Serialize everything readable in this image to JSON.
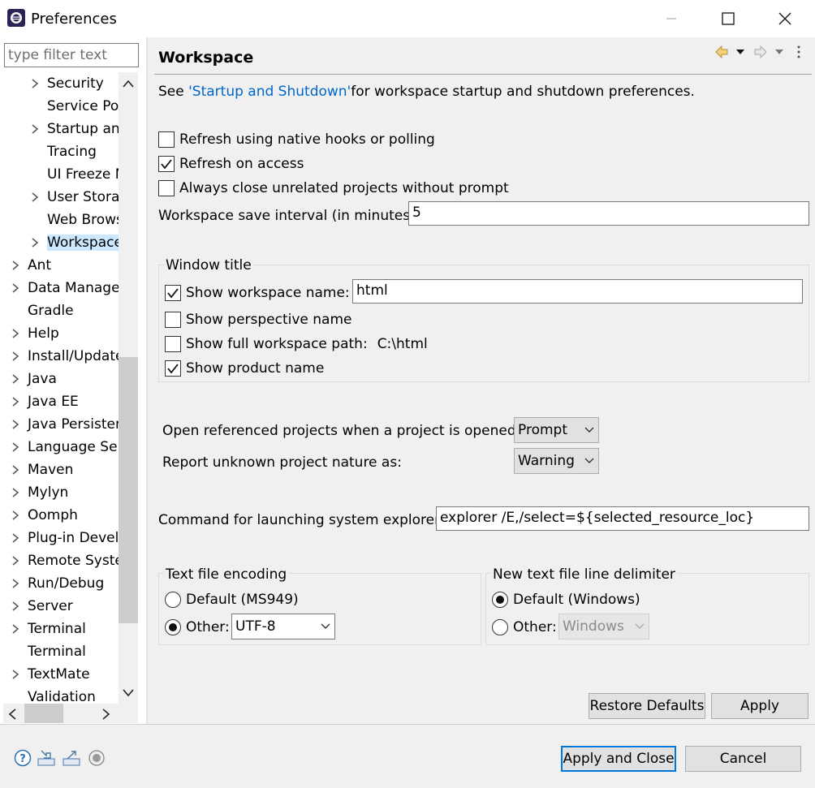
{
  "window": {
    "title": "Preferences"
  },
  "filter": {
    "placeholder": "type filter text"
  },
  "tree": {
    "items": [
      {
        "label": "Security",
        "expandable": true,
        "indent": 1
      },
      {
        "label": "Service Pol",
        "expandable": false,
        "indent": 1
      },
      {
        "label": "Startup and",
        "expandable": true,
        "indent": 1
      },
      {
        "label": "Tracing",
        "expandable": false,
        "indent": 1
      },
      {
        "label": "UI Freeze M",
        "expandable": false,
        "indent": 1
      },
      {
        "label": "User Storag",
        "expandable": true,
        "indent": 1
      },
      {
        "label": "Web Brows",
        "expandable": false,
        "indent": 1
      },
      {
        "label": "Workspace",
        "expandable": true,
        "indent": 1,
        "selected": true
      },
      {
        "label": "Ant",
        "expandable": true,
        "indent": 0
      },
      {
        "label": "Data Manager",
        "expandable": true,
        "indent": 0
      },
      {
        "label": "Gradle",
        "expandable": false,
        "indent": 0
      },
      {
        "label": "Help",
        "expandable": true,
        "indent": 0
      },
      {
        "label": "Install/Update",
        "expandable": true,
        "indent": 0
      },
      {
        "label": "Java",
        "expandable": true,
        "indent": 0
      },
      {
        "label": "Java EE",
        "expandable": true,
        "indent": 0
      },
      {
        "label": "Java Persisten",
        "expandable": true,
        "indent": 0
      },
      {
        "label": "Language Ser",
        "expandable": true,
        "indent": 0
      },
      {
        "label": "Maven",
        "expandable": true,
        "indent": 0
      },
      {
        "label": "Mylyn",
        "expandable": true,
        "indent": 0
      },
      {
        "label": "Oomph",
        "expandable": true,
        "indent": 0
      },
      {
        "label": "Plug-in Devel",
        "expandable": true,
        "indent": 0
      },
      {
        "label": "Remote Syste",
        "expandable": true,
        "indent": 0
      },
      {
        "label": "Run/Debug",
        "expandable": true,
        "indent": 0
      },
      {
        "label": "Server",
        "expandable": true,
        "indent": 0
      },
      {
        "label": "Terminal",
        "expandable": true,
        "indent": 0
      },
      {
        "label": "Terminal",
        "expandable": false,
        "indent": 0
      },
      {
        "label": "TextMate",
        "expandable": true,
        "indent": 0
      },
      {
        "label": "Validation",
        "expandable": false,
        "indent": 0
      }
    ]
  },
  "page": {
    "title": "Workspace",
    "intro_before": "See ",
    "intro_link": "'Startup and Shutdown'",
    "intro_after": " for workspace startup and shutdown preferences.",
    "refresh_native": {
      "label": "Refresh using native hooks or polling",
      "checked": false
    },
    "refresh_access": {
      "label": "Refresh on access",
      "checked": true
    },
    "always_close": {
      "label": "Always close unrelated projects without prompt",
      "checked": false
    },
    "save_interval_label": "Workspace save interval (in minutes):",
    "save_interval_value": "5",
    "window_title": {
      "group_label": "Window title",
      "show_ws_name": {
        "label": "Show workspace name:",
        "checked": true,
        "value": "html"
      },
      "show_perspective": {
        "label": "Show perspective name",
        "checked": false
      },
      "show_full_path": {
        "label": "Show full workspace path:",
        "checked": false,
        "path": "C:\\html"
      },
      "show_product": {
        "label": "Show product name",
        "checked": true
      }
    },
    "open_referenced_label": "Open referenced projects when a project is opened:",
    "open_referenced_value": "Prompt",
    "report_nature_label": "Report unknown project nature as:",
    "report_nature_value": "Warning",
    "explorer_label": "Command for launching system explorer:",
    "explorer_value": "explorer /E,/select=${selected_resource_loc}",
    "encoding": {
      "group_label": "Text file encoding",
      "default_label": "Default (MS949)",
      "other_label": "Other:",
      "other_value": "UTF-8",
      "selected": "other"
    },
    "delimiter": {
      "group_label": "New text file line delimiter",
      "default_label": "Default (Windows)",
      "other_label": "Other:",
      "other_value": "Windows",
      "selected": "default"
    },
    "restore_defaults": "Restore Defaults",
    "apply": "Apply"
  },
  "footer": {
    "apply_close": "Apply and Close",
    "cancel": "Cancel",
    "icons": [
      "help-icon",
      "import-icon",
      "export-icon",
      "oomph-record-icon"
    ]
  },
  "colors": {
    "link": "#0066cc",
    "selection": "#cce8ff",
    "default_button_border": "#0078d7",
    "pane_bg": "#f0f0f0"
  }
}
